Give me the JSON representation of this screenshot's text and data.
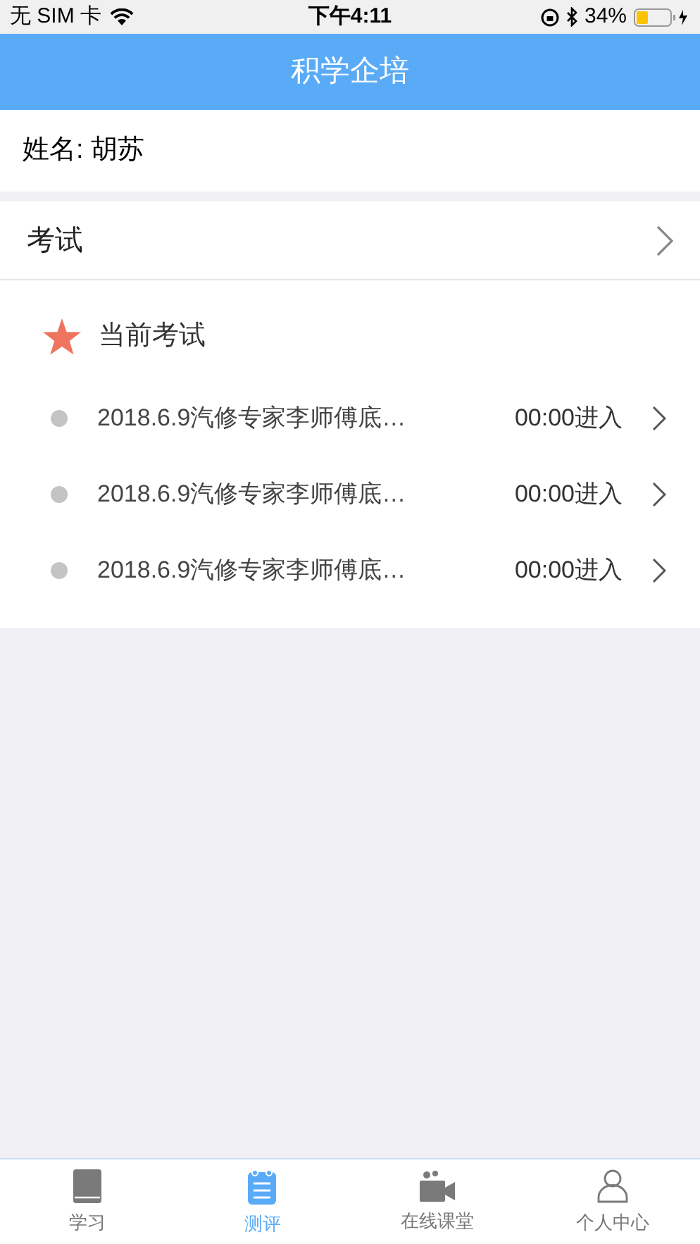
{
  "status_bar": {
    "carrier": "无 SIM 卡",
    "time": "下午4:11",
    "battery": "34%"
  },
  "header": {
    "title": "积学企培"
  },
  "profile": {
    "label": "姓名:",
    "name": "胡苏"
  },
  "exam_link": {
    "label": "考试"
  },
  "current_exams": {
    "heading": "当前考试",
    "items": [
      {
        "title": "2018.6.9汽修专家李师傅底…",
        "time": "00:00进入"
      },
      {
        "title": "2018.6.9汽修专家李师傅底…",
        "time": "00:00进入"
      },
      {
        "title": "2018.6.9汽修专家李师傅底…",
        "time": "00:00进入"
      }
    ]
  },
  "tab_bar": [
    {
      "kind": "book",
      "label": "学习",
      "selected": false
    },
    {
      "kind": "notepad",
      "label": "测评",
      "selected": true
    },
    {
      "kind": "camera",
      "label": "在线课堂",
      "selected": false
    },
    {
      "kind": "person",
      "label": "个人中心",
      "selected": false
    }
  ]
}
